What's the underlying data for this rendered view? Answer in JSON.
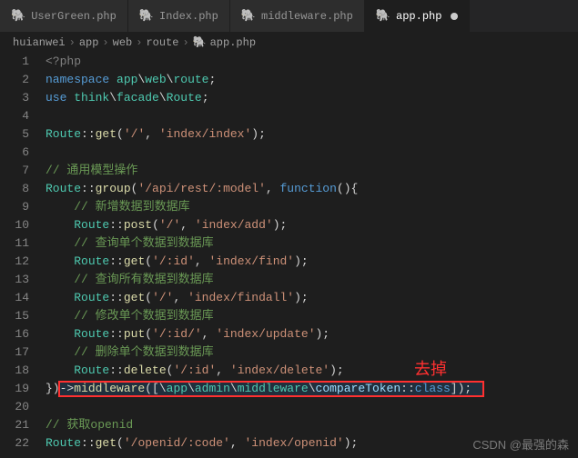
{
  "tabs": [
    {
      "label": "UserGreen.php"
    },
    {
      "label": "Index.php"
    },
    {
      "label": "middleware.php"
    },
    {
      "label": "app.php"
    }
  ],
  "breadcrumb": {
    "parts": [
      "huianwei",
      "app",
      "web",
      "route",
      "app.php"
    ]
  },
  "code": {
    "lines": [
      {
        "n": "1",
        "html": "<span class='k-tag'>&lt;?php</span>"
      },
      {
        "n": "2",
        "html": "<span class='k-kw'>namespace</span> <span class='k-ns'>app</span><span class='k-pn'>\\</span><span class='k-ns'>web</span><span class='k-pn'>\\</span><span class='k-ns'>route</span><span class='k-pn'>;</span>"
      },
      {
        "n": "3",
        "html": "<span class='k-kw'>use</span> <span class='k-ns'>think</span><span class='k-pn'>\\</span><span class='k-ns'>facade</span><span class='k-pn'>\\</span><span class='k-cls'>Route</span><span class='k-pn'>;</span>"
      },
      {
        "n": "4",
        "html": ""
      },
      {
        "n": "5",
        "html": "<span class='k-cls'>Route</span><span class='k-pn'>::</span><span class='k-fn'>get</span><span class='k-pn'>(</span><span class='k-str'>'/'</span><span class='k-pn'>, </span><span class='k-str'>'index/index'</span><span class='k-pn'>);</span>"
      },
      {
        "n": "6",
        "html": ""
      },
      {
        "n": "7",
        "html": "<span class='k-cmt'>// 通用模型操作</span>"
      },
      {
        "n": "8",
        "html": "<span class='k-cls'>Route</span><span class='k-pn'>::</span><span class='k-fn'>group</span><span class='k-pn'>(</span><span class='k-str'>'/api/rest/:model'</span><span class='k-pn'>, </span><span class='k-kw'>function</span><span class='k-pn'>(){</span>"
      },
      {
        "n": "9",
        "html": "    <span class='k-cmt'>// 新增数据到数据库</span>"
      },
      {
        "n": "10",
        "html": "    <span class='k-cls'>Route</span><span class='k-pn'>::</span><span class='k-fn'>post</span><span class='k-pn'>(</span><span class='k-str'>'/'</span><span class='k-pn'>, </span><span class='k-str'>'index/add'</span><span class='k-pn'>);</span>"
      },
      {
        "n": "11",
        "html": "    <span class='k-cmt'>// 查询单个数据到数据库</span>"
      },
      {
        "n": "12",
        "html": "    <span class='k-cls'>Route</span><span class='k-pn'>::</span><span class='k-fn'>get</span><span class='k-pn'>(</span><span class='k-str'>'/:id'</span><span class='k-pn'>, </span><span class='k-str'>'index/find'</span><span class='k-pn'>);</span>"
      },
      {
        "n": "13",
        "html": "    <span class='k-cmt'>// 查询所有数据到数据库</span>"
      },
      {
        "n": "14",
        "html": "    <span class='k-cls'>Route</span><span class='k-pn'>::</span><span class='k-fn'>get</span><span class='k-pn'>(</span><span class='k-str'>'/'</span><span class='k-pn'>, </span><span class='k-str'>'index/findall'</span><span class='k-pn'>);</span>"
      },
      {
        "n": "15",
        "html": "    <span class='k-cmt'>// 修改单个数据到数据库</span>"
      },
      {
        "n": "16",
        "html": "    <span class='k-cls'>Route</span><span class='k-pn'>::</span><span class='k-fn'>put</span><span class='k-pn'>(</span><span class='k-str'>'/:id/'</span><span class='k-pn'>, </span><span class='k-str'>'index/update'</span><span class='k-pn'>);</span>"
      },
      {
        "n": "17",
        "html": "    <span class='k-cmt'>// 删除单个数据到数据库</span>"
      },
      {
        "n": "18",
        "html": "    <span class='k-cls'>Route</span><span class='k-pn'>::</span><span class='k-fn'>delete</span><span class='k-pn'>(</span><span class='k-str'>'/:id'</span><span class='k-pn'>, </span><span class='k-str'>'index/delete'</span><span class='k-pn'>);</span>"
      },
      {
        "n": "19",
        "html": "<span class='k-pn'>})-&gt;</span><span class='k-fn'>middleware</span><span class='k-pn'>([</span><span class='k-pn'>\\</span><span class='k-ns'>app</span><span class='k-pn'>\\</span><span class='k-ns'>admin</span><span class='k-pn'>\\</span><span class='k-ns'>middleware</span><span class='k-pn'>\\</span><span class='k-var'>compareToken</span><span class='k-pn'>::</span><span class='k-kw'>class</span><span class='k-pn'>]);</span>"
      },
      {
        "n": "20",
        "html": ""
      },
      {
        "n": "21",
        "html": "<span class='k-cmt'>// 获取openid</span>"
      },
      {
        "n": "22",
        "html": "<span class='k-cls'>Route</span><span class='k-pn'>::</span><span class='k-fn'>get</span><span class='k-pn'>(</span><span class='k-str'>'/openid/:code'</span><span class='k-pn'>, </span><span class='k-str'>'index/openid'</span><span class='k-pn'>);</span>"
      }
    ]
  },
  "annotation": "去掉",
  "watermark": "CSDN @最强的森"
}
